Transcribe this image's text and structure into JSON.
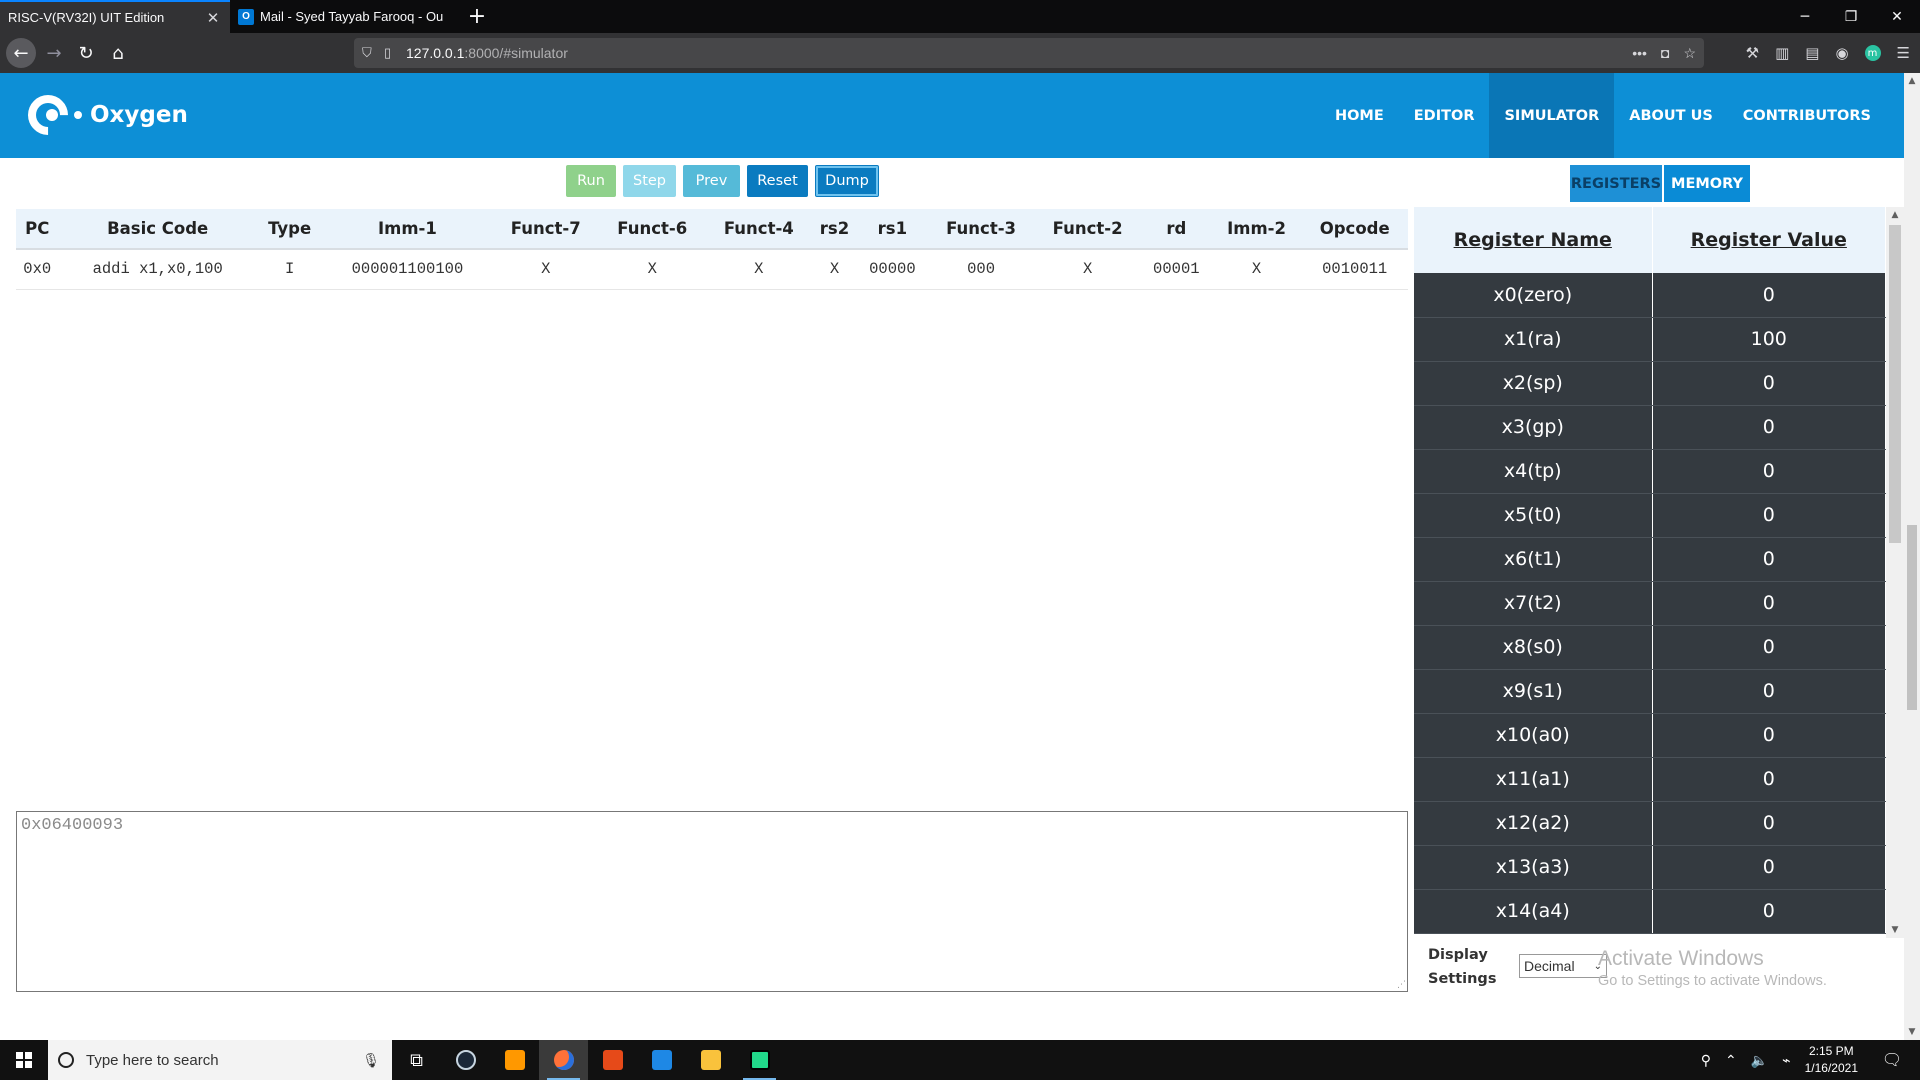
{
  "browser": {
    "tabs": [
      {
        "title": "RISC-V(RV32I) UIT Edition",
        "active": true
      },
      {
        "title": "Mail - Syed Tayyab Farooq - Ou",
        "active": false,
        "favicon": "O"
      }
    ],
    "url_host": "127.0.0.1",
    "url_path": ":8000/#simulator",
    "profile_initial": "m"
  },
  "header": {
    "logo_text": "Oxygen",
    "nav": [
      {
        "label": "HOME",
        "active": false
      },
      {
        "label": "EDITOR",
        "active": false
      },
      {
        "label": "SIMULATOR",
        "active": true
      },
      {
        "label": "ABOUT US",
        "active": false
      },
      {
        "label": "CONTRIBUTORS",
        "active": false
      }
    ]
  },
  "controls": {
    "run": "Run",
    "step": "Step",
    "prev": "Prev",
    "reset": "Reset",
    "dump": "Dump"
  },
  "instruction_table": {
    "headers": [
      "PC",
      "Basic Code",
      "Type",
      "Imm-1",
      "Funct-7",
      "Funct-6",
      "Funct-4",
      "rs2",
      "rs1",
      "Funct-3",
      "Funct-2",
      "rd",
      "Imm-2",
      "Opcode"
    ],
    "rows": [
      [
        "0x0",
        "addi x1,x0,100",
        "I",
        "000001100100",
        "X",
        "X",
        "X",
        "X",
        "00000",
        "000",
        "X",
        "00001",
        "X",
        "0010011"
      ]
    ]
  },
  "dump_text": "0x06400093",
  "panel_tabs": {
    "registers": "REGISTERS",
    "memory": "MEMORY"
  },
  "registers": {
    "headers": [
      "Register Name",
      "Register Value"
    ],
    "rows": [
      [
        "x0(zero)",
        "0"
      ],
      [
        "x1(ra)",
        "100"
      ],
      [
        "x2(sp)",
        "0"
      ],
      [
        "x3(gp)",
        "0"
      ],
      [
        "x4(tp)",
        "0"
      ],
      [
        "x5(t0)",
        "0"
      ],
      [
        "x6(t1)",
        "0"
      ],
      [
        "x7(t2)",
        "0"
      ],
      [
        "x8(s0)",
        "0"
      ],
      [
        "x9(s1)",
        "0"
      ],
      [
        "x10(a0)",
        "0"
      ],
      [
        "x11(a1)",
        "0"
      ],
      [
        "x12(a2)",
        "0"
      ],
      [
        "x13(a3)",
        "0"
      ],
      [
        "x14(a4)",
        "0"
      ]
    ]
  },
  "display_settings": {
    "label_line1": "Display",
    "label_line2": "Settings",
    "selected": "Decimal"
  },
  "watermark": {
    "line1": "Activate Windows",
    "line2": "Go to Settings to activate Windows."
  },
  "taskbar": {
    "search_placeholder": "Type here to search",
    "time": "2:15 PM",
    "date": "1/16/2021"
  }
}
